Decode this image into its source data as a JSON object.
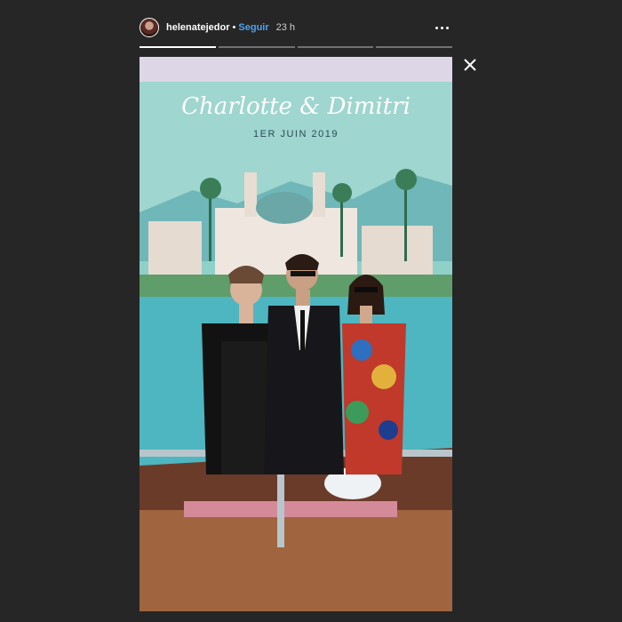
{
  "story": {
    "username": "helenatejedor",
    "separator": "•",
    "follow_label": "Seguir",
    "time_ago": "23 h",
    "segments": 4,
    "active_segment": 1
  },
  "poster": {
    "script_title": "Charlotte & Dimitri",
    "date": "1ER JUIN 2019"
  },
  "icons": {
    "more": "more-options-icon",
    "close": "close-icon"
  },
  "colors": {
    "background": "#262626",
    "follow": "#4aa3f0",
    "poster_sky": "#7fc4c0",
    "sea": "#4db6c0"
  }
}
